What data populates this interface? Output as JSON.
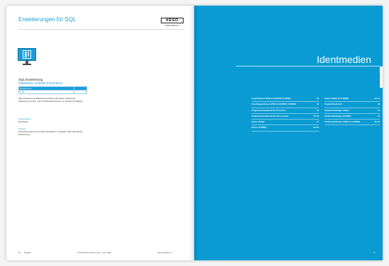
{
  "left_page": {
    "title": "Erweiterungen für SQL",
    "brand": {
      "logo": "KESO",
      "sub": "ASSA ABLOY"
    },
    "section_name": "SQL Erweiterung",
    "section_subtitle": "Mitarbeiter Austritts-Information",
    "table": {
      "header": [
        "Bestellnummer",
        ""
      ],
      "rows": [
        [
          "5.745",
          "€"
        ]
      ]
    },
    "description": "SQL Erweiterung Mitarbeiter Austritts-Information erlaubt die Erfassung von Ein- und Austrittsinformationen im Personen-Register.",
    "delivery_label": "Lieferumfang",
    "delivery_value": "Download",
    "hint_label": "Hinweis",
    "hint_value": "Voraussetzung ist eine SQL Datenbank, empfohlen SQL Datenbank Erweiterung.",
    "footer": {
      "page": "28",
      "section": "Software",
      "note": "Unverbindliche Preise in Euro – exkl. MwSt.",
      "url": "www.assaabloy.ch"
    }
  },
  "right_page": {
    "title": "Identmedien",
    "tab": "2",
    "toc_left": [
      {
        "title": "Langschlüssel 125kHz & DeDIVID 13.56MHz",
        "page": "22"
      },
      {
        "title": "Ersatzlangschlüssel 125kHz & DeDIVID 13.56MHz",
        "page": "23"
      },
      {
        "title": "Programmierschlüssel für PC-Version",
        "page": "24"
      },
      {
        "title": "Programmierschlüssel für Home-Version",
        "page": "25–26"
      },
      {
        "title": "Karten 125kHz",
        "page": "27"
      },
      {
        "title": "Karten 13.56MHz",
        "page": "28–29"
      }
    ],
    "toc_right": [
      {
        "title": "Karten 125kHz & 13.56MHz",
        "page": "30–31"
      },
      {
        "title": "Programmierkarten",
        "page": "32"
      },
      {
        "title": "Schlüsselanhänger 125kHz",
        "page": "33"
      },
      {
        "title": "Schlüsselanhänger 13.56MHz",
        "page": "34"
      },
      {
        "title": "Schlüsselanhänger 125kHz & 13.56MHz",
        "page": "35–36"
      }
    ],
    "footer": {
      "page": "21"
    }
  }
}
